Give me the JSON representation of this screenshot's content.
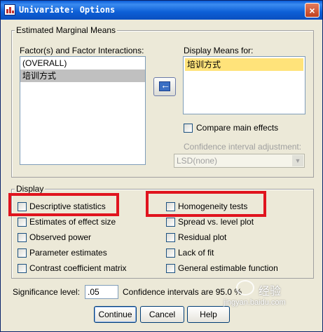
{
  "window": {
    "title": "Univariate: Options",
    "close_label": "×"
  },
  "emm": {
    "legend": "Estimated Marginal Means",
    "factors_label": "Factor(s) and Factor Interactions:",
    "factors": [
      "(OVERALL)",
      "培训方式"
    ],
    "display_label": "Display Means for:",
    "display_items": [
      "培训方式"
    ],
    "compare_label": "Compare main effects",
    "ci_adjust_label": "Confidence interval adjustment:",
    "ci_adjust_value": "LSD(none)"
  },
  "display": {
    "legend": "Display",
    "left": [
      "Descriptive statistics",
      "Estimates of effect size",
      "Observed power",
      "Parameter estimates",
      "Contrast coefficient matrix"
    ],
    "right": [
      "Homogeneity tests",
      "Spread vs. level plot",
      "Residual plot",
      "Lack of fit",
      "General estimable function"
    ]
  },
  "significance": {
    "label": "Significance level:",
    "value": ".05",
    "ci_text": "Confidence intervals are 95.0 %"
  },
  "buttons": {
    "continue": "Continue",
    "cancel": "Cancel",
    "help": "Help"
  },
  "watermark": {
    "site": "jingyan.baidu.com",
    "brand": "经验"
  },
  "colors": {
    "highlight_box": "#e0141e",
    "selection_yellow": "#ffe37a",
    "title_bar": "#0a5cd8"
  },
  "icons": {
    "app": "spss-chart-icon",
    "transfer": "arrow-left-icon"
  }
}
